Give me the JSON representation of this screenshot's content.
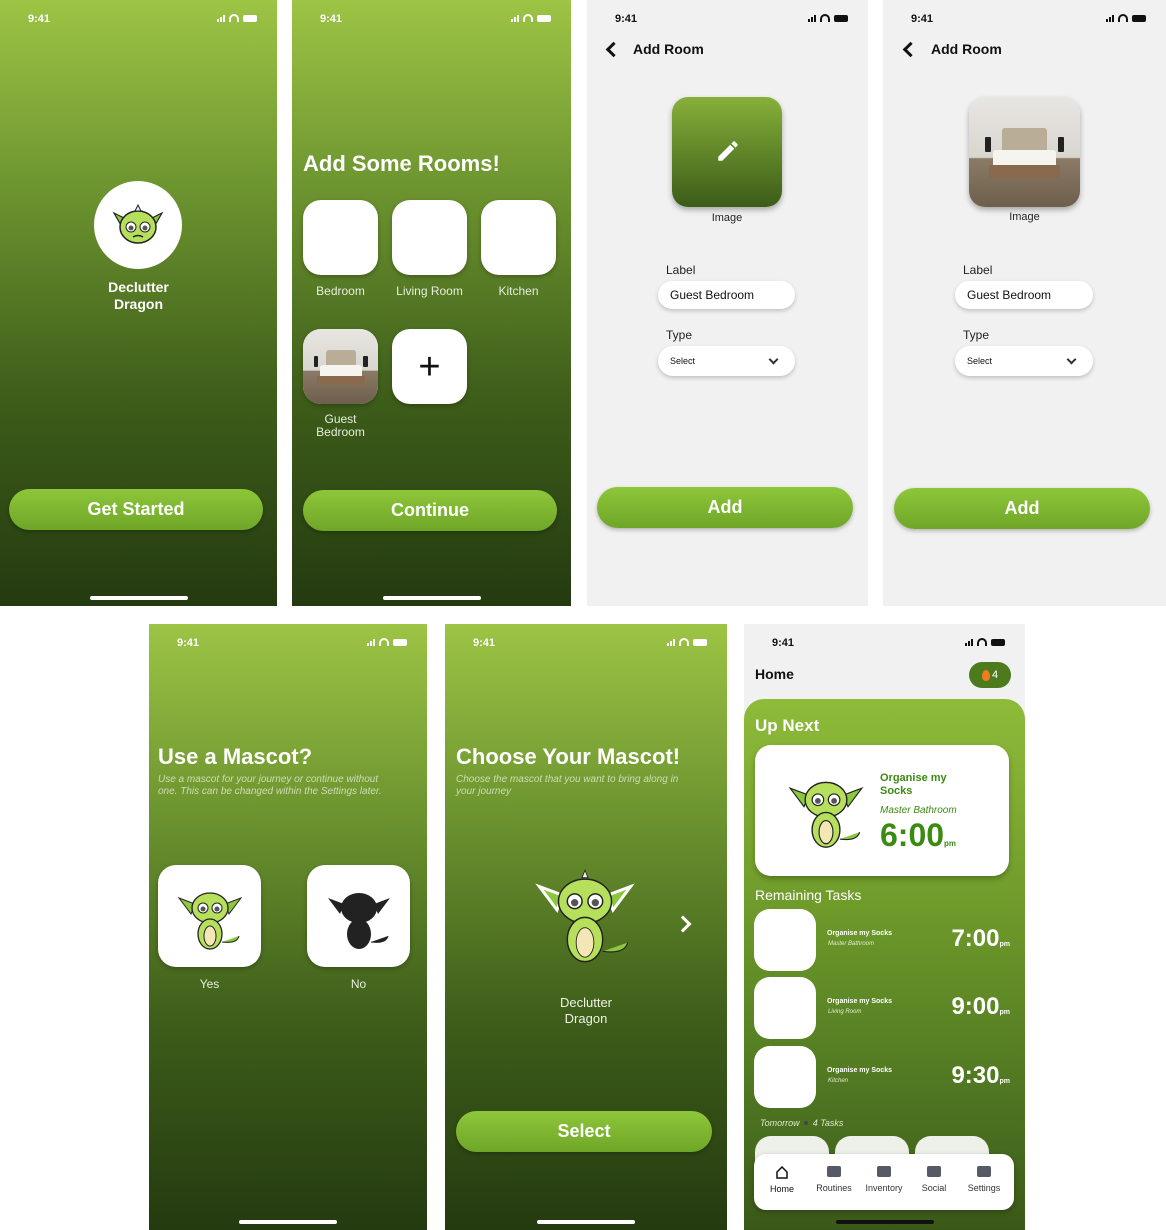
{
  "status_time": "9:41",
  "splash": {
    "app_name_line1": "Declutter",
    "app_name_line2": "Dragon",
    "button": "Get Started"
  },
  "rooms": {
    "title": "Add Some Rooms!",
    "items": [
      {
        "label": "Bedroom"
      },
      {
        "label": "Living Room"
      },
      {
        "label": "Kitchen"
      },
      {
        "label": "Guest Bedroom"
      }
    ],
    "add_symbol": "+",
    "button": "Continue"
  },
  "add_room": {
    "title": "Add Room",
    "image_label": "Image",
    "label_caption": "Label",
    "label_value": "Guest Bedroom",
    "type_caption": "Type",
    "type_value": "Select",
    "button": "Add"
  },
  "mascot_q": {
    "title": "Use a Mascot?",
    "subtitle": "Use a mascot for your journey or continue without one. This can be changed within the Settings later.",
    "yes": "Yes",
    "no": "No"
  },
  "choose": {
    "title": "Choose Your Mascot!",
    "subtitle": "Choose the mascot that you want to bring along in your journey",
    "name_line1": "Declutter",
    "name_line2": "Dragon",
    "button": "Select"
  },
  "home": {
    "title": "Home",
    "streak": "4",
    "up_next": "Up Next",
    "next_task_line1": "Organise my",
    "next_task_line2": "Socks",
    "next_room": "Master Bathroom",
    "next_time": "6:00",
    "next_ampm": "pm",
    "remaining": "Remaining Tasks",
    "tasks": [
      {
        "title": "Organise my Socks",
        "room": "Master Bathroom",
        "time": "7:00",
        "ampm": "pm"
      },
      {
        "title": "Organise my Socks",
        "room": "Living Room",
        "time": "9:00",
        "ampm": "pm"
      },
      {
        "title": "Organise my Socks",
        "room": "Kitchen",
        "time": "9:30",
        "ampm": "pm"
      }
    ],
    "tomorrow": "Tomorrow",
    "tomorrow_count": "4 Tasks",
    "nav": [
      "Home",
      "Routines",
      "Inventory",
      "Social",
      "Settings"
    ]
  },
  "colors": {
    "brand_green": "#7bb22e",
    "dark_green": "#243a10",
    "text_green": "#3b8a12"
  }
}
